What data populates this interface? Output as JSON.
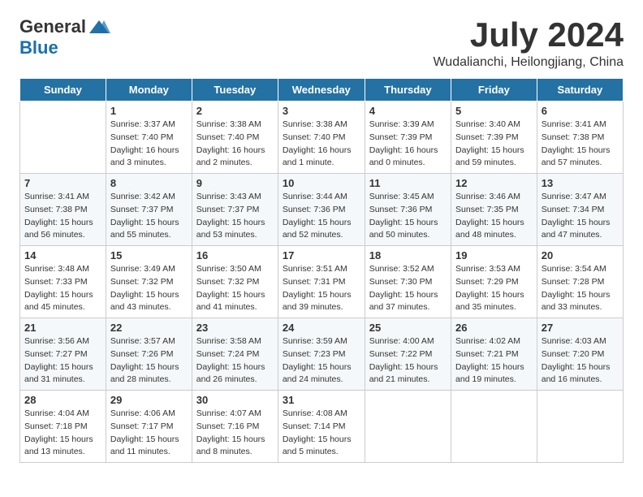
{
  "header": {
    "logo_general": "General",
    "logo_blue": "Blue",
    "month_title": "July 2024",
    "location": "Wudalianchi, Heilongjiang, China"
  },
  "days_of_week": [
    "Sunday",
    "Monday",
    "Tuesday",
    "Wednesday",
    "Thursday",
    "Friday",
    "Saturday"
  ],
  "weeks": [
    [
      {
        "day": "",
        "info": ""
      },
      {
        "day": "1",
        "info": "Sunrise: 3:37 AM\nSunset: 7:40 PM\nDaylight: 16 hours\nand 3 minutes."
      },
      {
        "day": "2",
        "info": "Sunrise: 3:38 AM\nSunset: 7:40 PM\nDaylight: 16 hours\nand 2 minutes."
      },
      {
        "day": "3",
        "info": "Sunrise: 3:38 AM\nSunset: 7:40 PM\nDaylight: 16 hours\nand 1 minute."
      },
      {
        "day": "4",
        "info": "Sunrise: 3:39 AM\nSunset: 7:39 PM\nDaylight: 16 hours\nand 0 minutes."
      },
      {
        "day": "5",
        "info": "Sunrise: 3:40 AM\nSunset: 7:39 PM\nDaylight: 15 hours\nand 59 minutes."
      },
      {
        "day": "6",
        "info": "Sunrise: 3:41 AM\nSunset: 7:38 PM\nDaylight: 15 hours\nand 57 minutes."
      }
    ],
    [
      {
        "day": "7",
        "info": "Sunrise: 3:41 AM\nSunset: 7:38 PM\nDaylight: 15 hours\nand 56 minutes."
      },
      {
        "day": "8",
        "info": "Sunrise: 3:42 AM\nSunset: 7:37 PM\nDaylight: 15 hours\nand 55 minutes."
      },
      {
        "day": "9",
        "info": "Sunrise: 3:43 AM\nSunset: 7:37 PM\nDaylight: 15 hours\nand 53 minutes."
      },
      {
        "day": "10",
        "info": "Sunrise: 3:44 AM\nSunset: 7:36 PM\nDaylight: 15 hours\nand 52 minutes."
      },
      {
        "day": "11",
        "info": "Sunrise: 3:45 AM\nSunset: 7:36 PM\nDaylight: 15 hours\nand 50 minutes."
      },
      {
        "day": "12",
        "info": "Sunrise: 3:46 AM\nSunset: 7:35 PM\nDaylight: 15 hours\nand 48 minutes."
      },
      {
        "day": "13",
        "info": "Sunrise: 3:47 AM\nSunset: 7:34 PM\nDaylight: 15 hours\nand 47 minutes."
      }
    ],
    [
      {
        "day": "14",
        "info": "Sunrise: 3:48 AM\nSunset: 7:33 PM\nDaylight: 15 hours\nand 45 minutes."
      },
      {
        "day": "15",
        "info": "Sunrise: 3:49 AM\nSunset: 7:32 PM\nDaylight: 15 hours\nand 43 minutes."
      },
      {
        "day": "16",
        "info": "Sunrise: 3:50 AM\nSunset: 7:32 PM\nDaylight: 15 hours\nand 41 minutes."
      },
      {
        "day": "17",
        "info": "Sunrise: 3:51 AM\nSunset: 7:31 PM\nDaylight: 15 hours\nand 39 minutes."
      },
      {
        "day": "18",
        "info": "Sunrise: 3:52 AM\nSunset: 7:30 PM\nDaylight: 15 hours\nand 37 minutes."
      },
      {
        "day": "19",
        "info": "Sunrise: 3:53 AM\nSunset: 7:29 PM\nDaylight: 15 hours\nand 35 minutes."
      },
      {
        "day": "20",
        "info": "Sunrise: 3:54 AM\nSunset: 7:28 PM\nDaylight: 15 hours\nand 33 minutes."
      }
    ],
    [
      {
        "day": "21",
        "info": "Sunrise: 3:56 AM\nSunset: 7:27 PM\nDaylight: 15 hours\nand 31 minutes."
      },
      {
        "day": "22",
        "info": "Sunrise: 3:57 AM\nSunset: 7:26 PM\nDaylight: 15 hours\nand 28 minutes."
      },
      {
        "day": "23",
        "info": "Sunrise: 3:58 AM\nSunset: 7:24 PM\nDaylight: 15 hours\nand 26 minutes."
      },
      {
        "day": "24",
        "info": "Sunrise: 3:59 AM\nSunset: 7:23 PM\nDaylight: 15 hours\nand 24 minutes."
      },
      {
        "day": "25",
        "info": "Sunrise: 4:00 AM\nSunset: 7:22 PM\nDaylight: 15 hours\nand 21 minutes."
      },
      {
        "day": "26",
        "info": "Sunrise: 4:02 AM\nSunset: 7:21 PM\nDaylight: 15 hours\nand 19 minutes."
      },
      {
        "day": "27",
        "info": "Sunrise: 4:03 AM\nSunset: 7:20 PM\nDaylight: 15 hours\nand 16 minutes."
      }
    ],
    [
      {
        "day": "28",
        "info": "Sunrise: 4:04 AM\nSunset: 7:18 PM\nDaylight: 15 hours\nand 13 minutes."
      },
      {
        "day": "29",
        "info": "Sunrise: 4:06 AM\nSunset: 7:17 PM\nDaylight: 15 hours\nand 11 minutes."
      },
      {
        "day": "30",
        "info": "Sunrise: 4:07 AM\nSunset: 7:16 PM\nDaylight: 15 hours\nand 8 minutes."
      },
      {
        "day": "31",
        "info": "Sunrise: 4:08 AM\nSunset: 7:14 PM\nDaylight: 15 hours\nand 5 minutes."
      },
      {
        "day": "",
        "info": ""
      },
      {
        "day": "",
        "info": ""
      },
      {
        "day": "",
        "info": ""
      }
    ]
  ]
}
